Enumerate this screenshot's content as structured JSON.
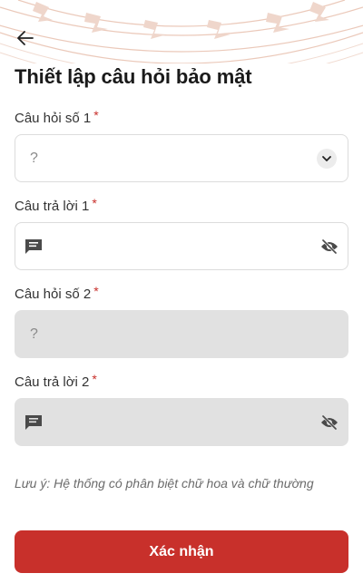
{
  "header": {
    "title": "Thiết lập câu hỏi bảo mật",
    "back_icon": "arrow-left-icon"
  },
  "form": {
    "question_1": {
      "label": "Câu hỏi số 1",
      "required_mark": "*",
      "value": "?"
    },
    "answer_1": {
      "label": "Câu trả lời 1",
      "required_mark": "*",
      "value": ""
    },
    "question_2": {
      "label": "Câu hỏi số 2",
      "required_mark": "*",
      "value": "?"
    },
    "answer_2": {
      "label": "Câu trả lời 2",
      "required_mark": "*",
      "value": ""
    }
  },
  "note": "Lưu ý: Hệ thống có phân biệt chữ hoa và chữ thường",
  "confirm_label": "Xác nhận",
  "colors": {
    "accent": "#c8302b",
    "disabled_field": "#e1e1e1",
    "header_pattern": "#e9c4b4"
  }
}
